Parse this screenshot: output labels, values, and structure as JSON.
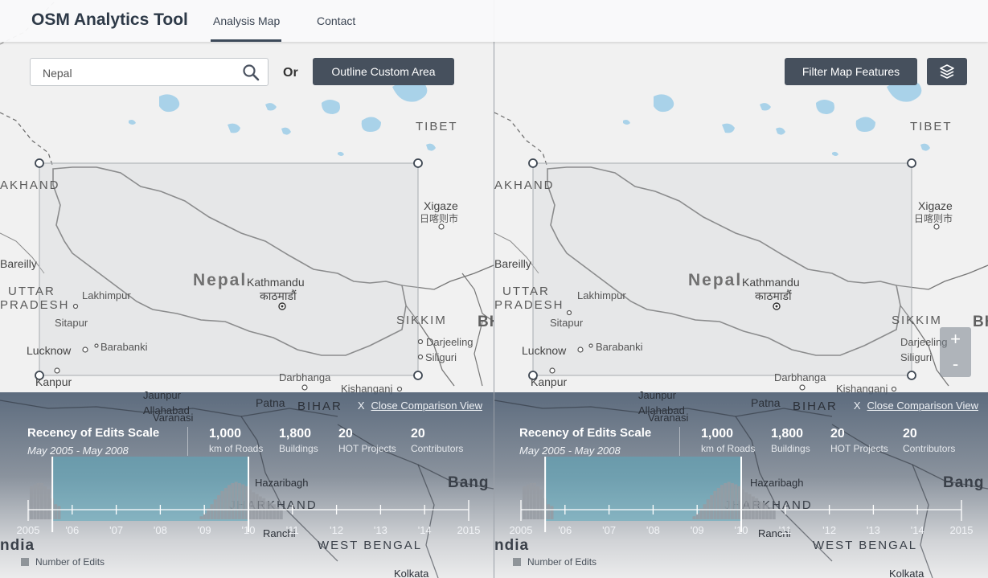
{
  "header": {
    "brand": "OSM Analytics Tool",
    "nav": [
      "Analysis Map",
      "Contact"
    ]
  },
  "search": {
    "value": "Nepal",
    "icon": "search-icon"
  },
  "or_label": "Or",
  "outline_button": "Outline Custom Area",
  "filter_button": "Filter Map Features",
  "layers_icon": "layers-icon",
  "zoom": {
    "in": "+",
    "out": "-"
  },
  "map_labels": {
    "tibet": "TIBET",
    "khand": "AKHAND",
    "xigaze": "Xigaze",
    "xigaze_cjk": "日喀则市",
    "nepal": "Nepal",
    "kathmandu": "Kathmandu",
    "kathmandu_ne": "काठमाडौं",
    "bareilly": "Bareilly",
    "uttar": "UTTAR",
    "pradesh": "PRADESH",
    "lakhimpur": "Lakhimpur",
    "sitapur": "Sitapur",
    "sikkim": "SIKKIM",
    "bh": "BH",
    "darjeeling": "Darjeeling",
    "siliguri": "Siliguri",
    "lucknow": "Lucknow",
    "barabanki": "Barabanki",
    "kanpur": "Kanpur",
    "darbhanga": "Darbhanga",
    "kishanganj": "Kishanganj",
    "jaunpur": "Jaunpur",
    "patna": "Patna",
    "bihar": "BIHAR",
    "allahabad": "Allahabad",
    "varanasi": "Varanasi",
    "hazaribagh": "Hazaribagh",
    "jharkhand": "JHARKHAND",
    "bang": "Bang",
    "ranchi": "Ranchi",
    "west_bengal": "WEST BENGAL",
    "ndia": "ndia",
    "kolkata": "Kolkata"
  },
  "panels": [
    {
      "close_x": "X",
      "close_label": "Close Comparison View",
      "title": "Recency of Edits Scale",
      "range": "May 2005 - May 2008",
      "stats": [
        {
          "num": "1,000",
          "label": "km of Roads"
        },
        {
          "num": "1,800",
          "label": "Buildings"
        },
        {
          "num": "20",
          "label": "HOT Projects"
        },
        {
          "num": "20",
          "label": "Contributors"
        }
      ],
      "legend": "Number of Edits"
    },
    {
      "close_x": "X",
      "close_label": "Close Comparison View",
      "title": "Recency of Edits Scale",
      "range": "May 2005 - May 2008",
      "stats": [
        {
          "num": "1,000",
          "label": "km of Roads"
        },
        {
          "num": "1,800",
          "label": "Buildings"
        },
        {
          "num": "20",
          "label": "HOT Projects"
        },
        {
          "num": "20",
          "label": "Contributors"
        }
      ],
      "legend": "Number of Edits"
    }
  ],
  "timeline": {
    "ticks": [
      "2005",
      "'06",
      "'07",
      "'08",
      "'09",
      "'10",
      "'11",
      "'12",
      "'13",
      "'14",
      "2015"
    ],
    "selection_start": 0.055,
    "selection_end": 0.5,
    "histogram": [
      0.55,
      0.58,
      0.6,
      0.6,
      0.55,
      0.5,
      0.35,
      0.25,
      0.22,
      0.0,
      0.0,
      0.0,
      0.0,
      0.0,
      0.0,
      0.0,
      0.0,
      0.0,
      0.0,
      0.0,
      0.0,
      0.0,
      0.0,
      0.0,
      0.0,
      0.0,
      0.0,
      0.0,
      0.0,
      0.0,
      0.0,
      0.0,
      0.0,
      0.0,
      0.0,
      0.0,
      0.0,
      0.0,
      0.0,
      0.0,
      0.0,
      0.0,
      0.0,
      0.0,
      0.0,
      0.0,
      0.0,
      0.0,
      0.0,
      0.05,
      0.1,
      0.18,
      0.25,
      0.33,
      0.4,
      0.47,
      0.52,
      0.57,
      0.6,
      0.62,
      0.6,
      0.58,
      0.55,
      0.5,
      0.45,
      0.42,
      0.38,
      0.35,
      0.3,
      0.28,
      0.25,
      0.2,
      0.15
    ]
  }
}
